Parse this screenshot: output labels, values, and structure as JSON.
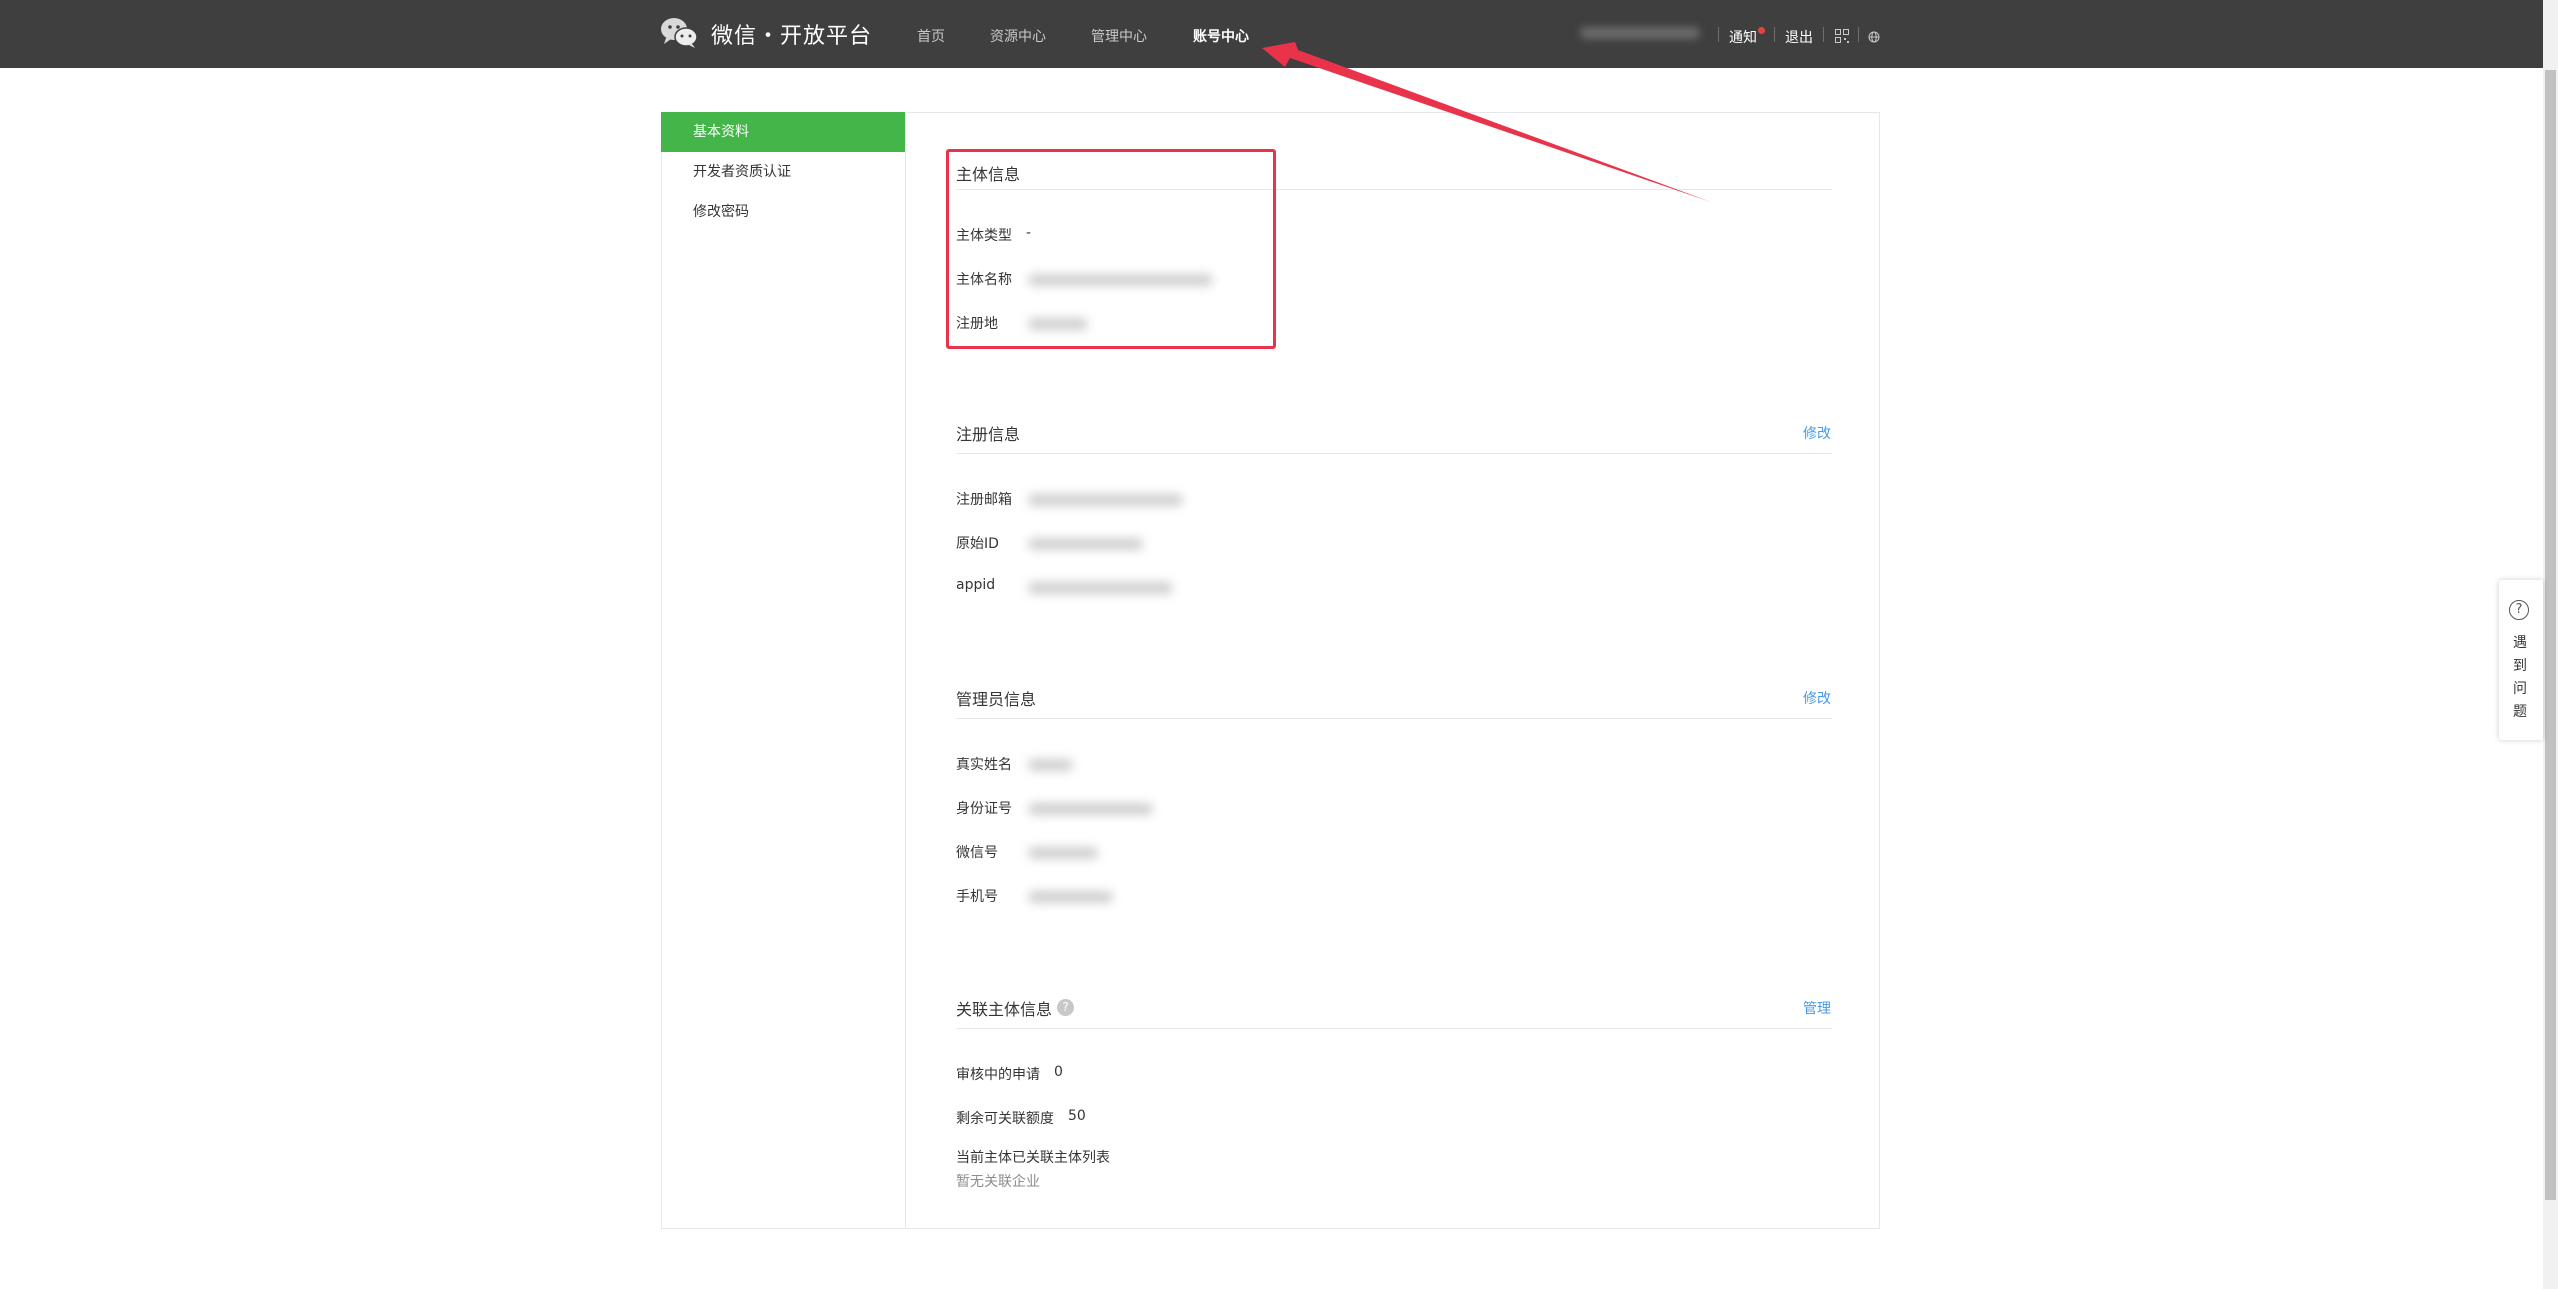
{
  "brand": {
    "logo_text": "微信・开放平台"
  },
  "nav": {
    "items": [
      "首页",
      "资源中心",
      "管理中心",
      "账号中心"
    ],
    "active_index": 3
  },
  "topbar": {
    "notice": "通知",
    "logout": "退出",
    "qr_icon": "qr-code-icon",
    "globe_icon": "globe-icon"
  },
  "sidebar": {
    "items": [
      "基本资料",
      "开发者资质认证",
      "修改密码"
    ],
    "active_index": 0
  },
  "subject": {
    "title": "主体信息",
    "type_label": "主体类型",
    "type_value": "-",
    "name_label": "主体名称",
    "region_label": "注册地"
  },
  "registration": {
    "title": "注册信息",
    "edit": "修改",
    "email_label": "注册邮箱",
    "origin_id_label": "原始ID",
    "appid_label": "appid"
  },
  "admin": {
    "title": "管理员信息",
    "edit": "修改",
    "name_label": "真实姓名",
    "id_label": "身份证号",
    "wechat_label": "微信号",
    "phone_label": "手机号"
  },
  "linked": {
    "title": "关联主体信息",
    "help": "?",
    "manage": "管理",
    "pending_label": "审核中的申请",
    "pending_value": "0",
    "quota_label": "剩余可关联额度",
    "quota_value": "50",
    "list_label": "当前主体已关联主体列表",
    "empty_text": "暂无关联企业"
  },
  "float_help": {
    "icon": "?",
    "text": "遇到问题"
  },
  "colors": {
    "topbar": "#3f3f3f",
    "accent_green": "#44b549",
    "link_blue": "#459ae9",
    "annotation_red": "#e8334a"
  }
}
